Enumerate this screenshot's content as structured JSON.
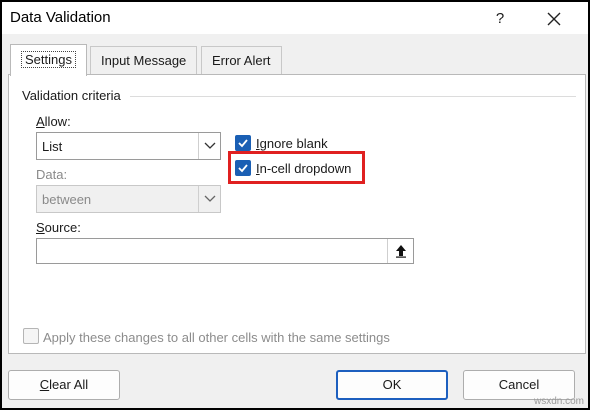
{
  "window": {
    "title": "Data Validation",
    "help_icon": "question-mark-icon",
    "close_icon": "close-icon"
  },
  "tabs": [
    {
      "label": "Settings",
      "active": true
    },
    {
      "label": "Input Message",
      "active": false
    },
    {
      "label": "Error Alert",
      "active": false
    }
  ],
  "settings": {
    "group_title": "Validation criteria",
    "allow": {
      "label_access": "A",
      "label_rest": "llow:",
      "value": "List"
    },
    "data": {
      "label": "Data:",
      "value": "between"
    },
    "ignore_blank": {
      "label_pre": "",
      "label_access": "I",
      "label_post": "gnore blank",
      "checked": true
    },
    "in_cell_dropdown": {
      "label_access": "I",
      "label_post": "n-cell dropdown",
      "checked": true,
      "highlight_color": "#e02020"
    },
    "source": {
      "label_access": "S",
      "label_rest": "ource:",
      "value": ""
    },
    "apply_all": {
      "label": "Apply these changes to all other cells with the same settings",
      "checked": false
    }
  },
  "buttons": {
    "clear_all_access": "C",
    "clear_all_rest": "lear All",
    "ok": "OK",
    "cancel": "Cancel"
  },
  "watermark": "wsxdn.com",
  "colors": {
    "checkbox": "#1a5fb4",
    "highlight": "#e02020",
    "default_button_border": "#1d5fbf"
  }
}
